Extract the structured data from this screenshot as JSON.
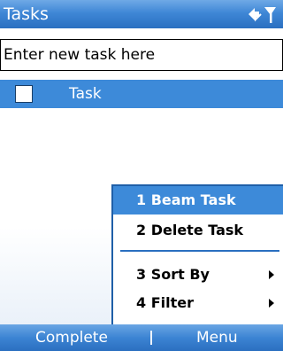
{
  "title_bar": {
    "title": "Tasks",
    "icons": [
      "connectivity-icon",
      "signal-icon"
    ]
  },
  "new_task": {
    "placeholder": "Enter new task here"
  },
  "tasks": [
    {
      "label": "Task",
      "checked": false,
      "selected": true
    }
  ],
  "context_menu": {
    "items": [
      {
        "label": "1 Beam Task",
        "selected": true,
        "submenu": false
      },
      {
        "label": "2 Delete Task",
        "selected": false,
        "submenu": false
      },
      {
        "label": "3 Sort By",
        "selected": false,
        "submenu": true
      },
      {
        "label": "4 Filter",
        "selected": false,
        "submenu": true
      }
    ]
  },
  "softkeys": {
    "left": "Complete",
    "right": "Menu"
  },
  "colors": {
    "accent": "#3d8ad9",
    "bar_dark": "#2a6fc0"
  }
}
